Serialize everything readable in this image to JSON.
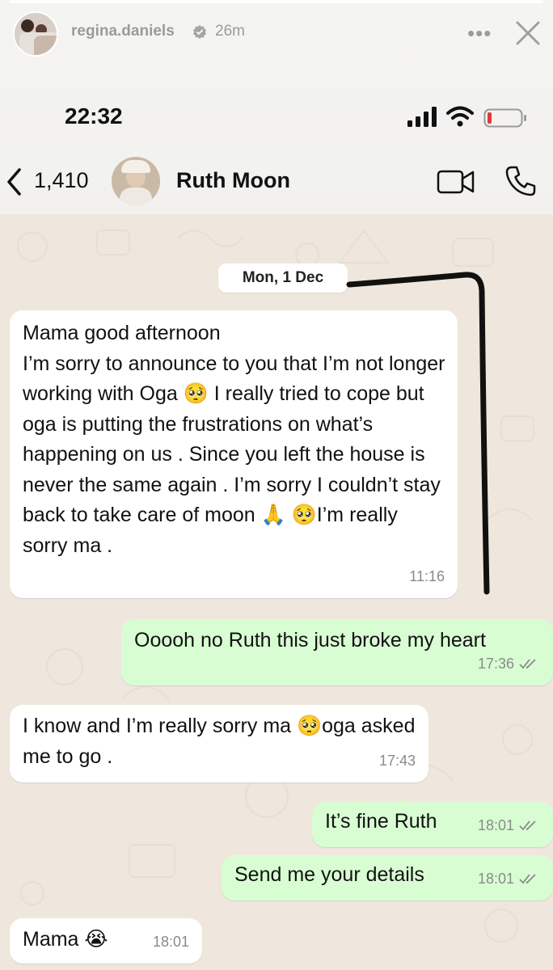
{
  "story": {
    "username": "regina.daniels",
    "time_ago": "26m",
    "more_label": "•••"
  },
  "status_bar": {
    "time": "22:32"
  },
  "chat_header": {
    "back_count": "1,410",
    "contact_name": "Ruth Moon"
  },
  "date_separator": "Mon, 1 Dec",
  "messages": [
    {
      "direction": "incoming",
      "text": "Mama good afternoon\nI’m sorry to announce to you that I’m not longer working with Oga 🥺 I really tried to cope but oga is putting the frustrations on what’s happening on us . Since you left the house is never the same again . I’m sorry I couldn’t stay back to take care of moon 🙏 🥺I’m really sorry ma .",
      "time": "11:16"
    },
    {
      "direction": "outgoing",
      "text": "Ooooh no Ruth this just broke my heart",
      "time": "17:36"
    },
    {
      "direction": "incoming",
      "text": "I know and I’m really sorry ma 🥺oga asked me to go .",
      "time": "17:43"
    },
    {
      "direction": "outgoing",
      "text": "It’s fine Ruth",
      "time": "18:01"
    },
    {
      "direction": "outgoing",
      "text": "Send me your details",
      "time": "18:01"
    },
    {
      "direction": "incoming",
      "text": "Mama 😭",
      "time": "18:01"
    }
  ],
  "colors": {
    "incoming_bubble": "#ffffff",
    "outgoing_bubble": "#d9fdd3",
    "chat_background": "#efe7dd",
    "tick_read": "#8a8a8a",
    "annotation_stroke": "#111111"
  }
}
